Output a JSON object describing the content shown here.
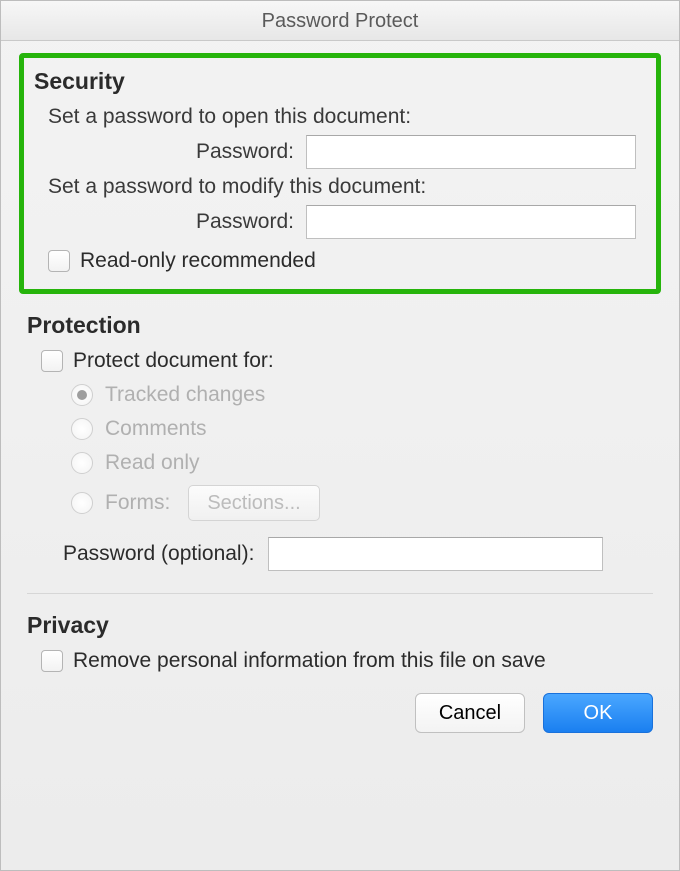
{
  "title": "Password Protect",
  "security": {
    "heading": "Security",
    "open_desc": "Set a password to open this document:",
    "open_label": "Password:",
    "open_value": "",
    "modify_desc": "Set a password to modify this document:",
    "modify_label": "Password:",
    "modify_value": "",
    "readonly_label": "Read-only recommended"
  },
  "protection": {
    "heading": "Protection",
    "protect_for_label": "Protect document for:",
    "options": {
      "tracked": "Tracked changes",
      "comments": "Comments",
      "readonly": "Read only",
      "forms": "Forms:"
    },
    "sections_button": "Sections...",
    "optional_pw_label": "Password (optional):",
    "optional_pw_value": ""
  },
  "privacy": {
    "heading": "Privacy",
    "remove_label": "Remove personal information from this file on save"
  },
  "buttons": {
    "cancel": "Cancel",
    "ok": "OK"
  }
}
